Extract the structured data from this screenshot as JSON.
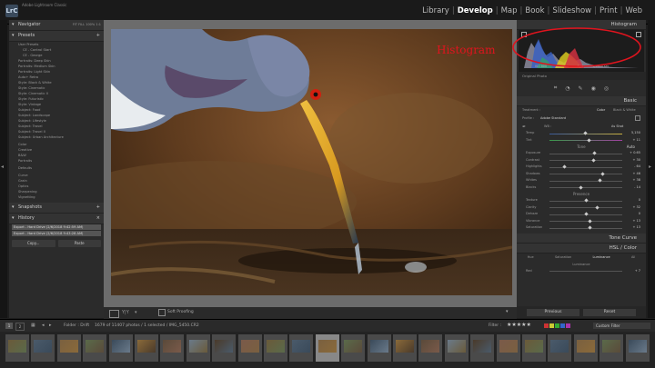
{
  "app": {
    "title": "Adobe Lightroom Classic",
    "logo": "LrC"
  },
  "modules": [
    {
      "label": "Library",
      "active": false
    },
    {
      "label": "Develop",
      "active": true
    },
    {
      "label": "Map",
      "active": false
    },
    {
      "label": "Book",
      "active": false
    },
    {
      "label": "Slideshow",
      "active": false
    },
    {
      "label": "Print",
      "active": false
    },
    {
      "label": "Web",
      "active": false
    }
  ],
  "left_panel": {
    "navigator": {
      "title": "Navigator",
      "zoom": [
        "FIT",
        "FILL",
        "100%",
        "1:1"
      ]
    },
    "presets": {
      "title": "Presets",
      "items": [
        "User Presets",
        "CE - Control Start",
        "CE - George",
        "Portraits: Deep Skin",
        "Portraits: Medium Skin",
        "Portraits: Light Skin",
        "Auto+ Retro",
        "Style: Black & White",
        "Style: Cinematic",
        "Style: Cinematic II",
        "Style: Futuristic",
        "Style: Vintage",
        "Subject: Food",
        "Subject: Landscape",
        "Subject: Lifestyle",
        "Subject: Travel",
        "Subject: Travel II",
        "Subject: Urban Architecture",
        "Color",
        "Creative",
        "B&W",
        "Portraits",
        "Defaults",
        "Curve",
        "Grain",
        "Optics",
        "Sharpening",
        "Vignetting"
      ]
    },
    "snapshots": {
      "title": "Snapshots"
    },
    "history": {
      "title": "History",
      "rows": [
        "Export - Hard Drive (2/6/2018 9:42:59 AM)",
        "Export - Hard Drive (2/6/2018 9:43:28 AM)"
      ]
    },
    "buttons": {
      "copy": "Copy...",
      "paste": "Paste"
    }
  },
  "annotation": {
    "text": "Histogram",
    "color": "#e0141e"
  },
  "right_panel": {
    "histogram_title": "Histogram",
    "histogram_info": [
      "ISO 800",
      "300 mm",
      "f / 8",
      "1/2000 sec"
    ],
    "original_photo": "Original Photo",
    "basic": {
      "title": "Basic",
      "treatment_label": "Treatment :",
      "treatment_options": [
        "Color",
        "Black & White"
      ],
      "profile_label": "Profile :",
      "profile_value": "Adobe Standard",
      "wb_label": "WB :",
      "wb_value": "As Shot",
      "temp": {
        "label": "Temp",
        "value": "5,150"
      },
      "tint": {
        "label": "Tint",
        "value": "+ 11"
      },
      "tone_label": "Tone",
      "auto_label": "Auto",
      "tone_sliders": [
        {
          "label": "Exposure",
          "value": "+ 0.65",
          "pos": 0.62
        },
        {
          "label": "Contrast",
          "value": "+ 30",
          "pos": 0.6
        },
        {
          "label": "Highlights",
          "value": "- 64",
          "pos": 0.2
        },
        {
          "label": "Shadows",
          "value": "+ 46",
          "pos": 0.73
        },
        {
          "label": "Whites",
          "value": "+ 38",
          "pos": 0.69
        },
        {
          "label": "Blacks",
          "value": "- 14",
          "pos": 0.43
        }
      ],
      "presence_label": "Presence",
      "presence_sliders": [
        {
          "label": "Texture",
          "value": "0",
          "pos": 0.5
        },
        {
          "label": "Clarity",
          "value": "+ 32",
          "pos": 0.66
        },
        {
          "label": "Dehaze",
          "value": "0",
          "pos": 0.5
        },
        {
          "label": "Vibrance",
          "value": "+ 13",
          "pos": 0.56
        },
        {
          "label": "Saturation",
          "value": "+ 13",
          "pos": 0.56
        }
      ]
    },
    "tone_curve": "Tone Curve",
    "hsl": {
      "title": "HSL / Color",
      "tabs": [
        "Hue",
        "Saturation",
        "Luminance",
        "All"
      ],
      "luminance_label": "Luminance",
      "red_label": "Red",
      "red_value": "+ 7"
    },
    "buttons": {
      "previous": "Previous",
      "reset": "Reset"
    }
  },
  "toolbar": {
    "soft_proofing": "Soft Proofing"
  },
  "filmstrip": {
    "pages": [
      "1",
      "2"
    ],
    "folder": "Folder : Drift",
    "info": "1679 of 11407 photos / 1 selected / IMG_5450.CR2",
    "filter_label": "Filter :",
    "custom_filter": "Custom Filter",
    "stars_label": "★★★★★"
  },
  "colors": {
    "accent": "#e0141e",
    "panel": "#2b2b2b",
    "center": "#6c6c6c"
  }
}
